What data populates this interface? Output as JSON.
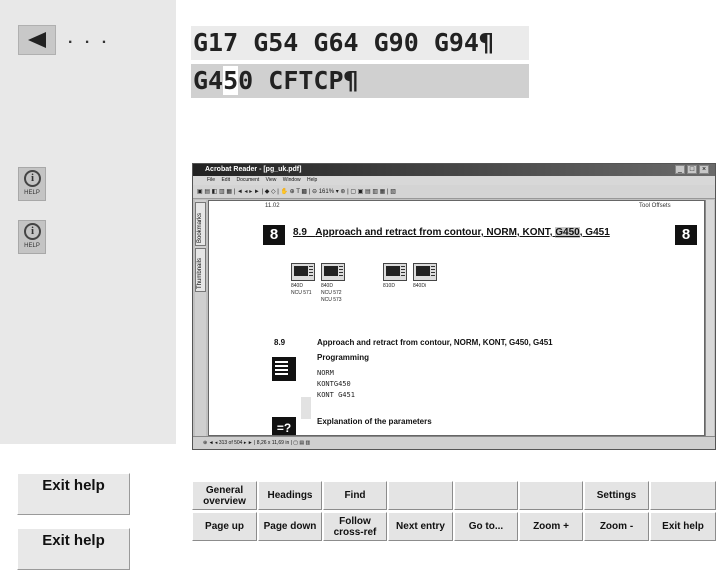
{
  "left_panel": {
    "back_icon": "left-triangle",
    "dots": ". . .",
    "help_icons": [
      {
        "icon": "info-icon",
        "label": "HELP"
      },
      {
        "icon": "info-icon",
        "label": "HELP"
      }
    ]
  },
  "gcode": {
    "line1": "G17 G54 G64 G90 G94¶",
    "line2_pre": "G4",
    "line2_cursor": "5",
    "line2_post": "0 CFTCP¶"
  },
  "acrobat": {
    "title": "Acrobat Reader - [pg_uk.pdf]",
    "menu": [
      "File",
      "Edit",
      "Document",
      "View",
      "Window",
      "Help"
    ],
    "toolbar_zoom": "161%",
    "side_tabs": [
      "Bookmarks",
      "Thumbnails"
    ],
    "page": {
      "header_left": "11.02",
      "header_right": "Tool Offsets",
      "chapter": "8",
      "section_number": "8.9",
      "title_pre": "Approach and retract from contour, NORM, KONT, ",
      "title_hl": "G450",
      "title_post": ", G451",
      "controls": [
        {
          "line1": "840D",
          "line2": "NCU 571",
          "line3": ""
        },
        {
          "line1": "840D",
          "line2": "NCU 572",
          "line3": "NCU 573"
        },
        {
          "line1": "810D",
          "line2": "",
          "line3": ""
        },
        {
          "line1": "840Di",
          "line2": "",
          "line3": ""
        }
      ],
      "section_heading_num": "8.9",
      "section_heading": "Approach and retract from contour, NORM, KONT, G450, G451",
      "programming": "Programming",
      "code": [
        "NORM",
        "KONTG450",
        "KONT G451"
      ],
      "explanation": "Explanation of the parameters",
      "explanation_icon": "=?"
    },
    "status": {
      "page_of": "313 of 504",
      "page_size": "8,26 x 11,69 in"
    }
  },
  "softkeys": {
    "exit_help_top": "Exit help",
    "exit_help_bottom": "Exit help",
    "row1": [
      "General overview",
      "Headings",
      "Find",
      "",
      "",
      "",
      "Settings",
      ""
    ],
    "row2": [
      "Page up",
      "Page down",
      "Follow cross-ref",
      "Next entry",
      "Go to...",
      "Zoom +",
      "Zoom -",
      "Exit help"
    ]
  }
}
